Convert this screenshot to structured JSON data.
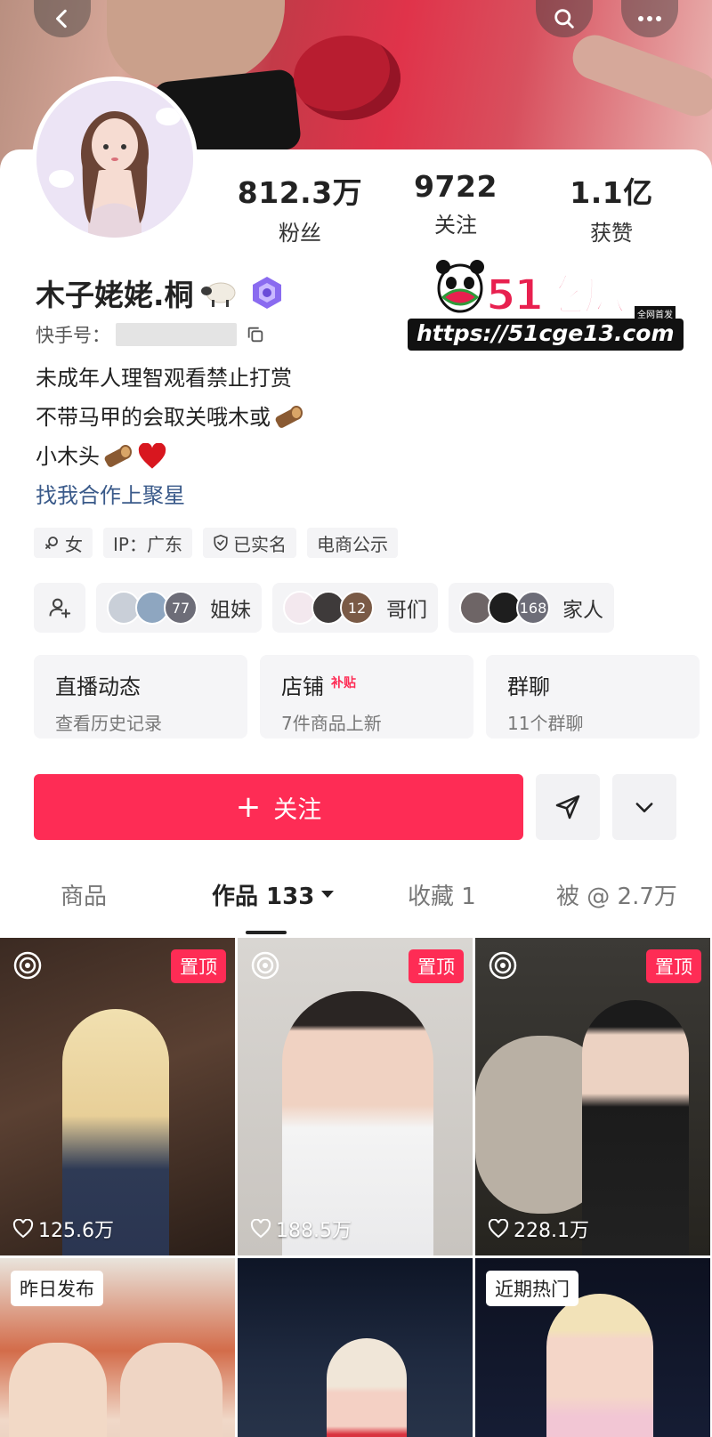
{
  "profile": {
    "stats": [
      {
        "value": "812.3万",
        "label": "粉丝"
      },
      {
        "value": "9722",
        "label": "关注"
      },
      {
        "value": "1.1亿",
        "label": "获赞"
      }
    ],
    "name": "木子姥姥.桐",
    "id_label": "快手号：",
    "bio": [
      "未成年人理智观看禁止打赏",
      "不带马甲的会取关哦木或",
      "小木头"
    ],
    "link": "找我合作上聚星",
    "tags": [
      "女",
      "IP：广东",
      "已实名",
      "电商公示"
    ]
  },
  "groups": [
    {
      "count": "77",
      "label": "姐妹"
    },
    {
      "count": "12",
      "label": "哥们"
    },
    {
      "count": "168",
      "label": "家人"
    }
  ],
  "quick_cards": [
    {
      "title": "直播动态",
      "badge": "",
      "sub": "查看历史记录"
    },
    {
      "title": "店铺",
      "badge": "补贴",
      "sub": "7件商品上新"
    },
    {
      "title": "群聊",
      "badge": "",
      "sub": "11个群聊"
    }
  ],
  "actions": {
    "follow_label": "关注"
  },
  "tabs": [
    {
      "label": "商品"
    },
    {
      "label": "作品 133"
    },
    {
      "label": "收藏 1"
    },
    {
      "label": "被 @ 2.7万"
    }
  ],
  "posts": [
    {
      "pin": "置顶",
      "likes": "125.6万"
    },
    {
      "pin": "置顶",
      "likes": "188.5万"
    },
    {
      "pin": "置顶",
      "likes": "228.1万"
    }
  ],
  "posts_row2": [
    {
      "label": "昨日发布"
    },
    {
      "label": ""
    },
    {
      "label": "近期热门"
    }
  ],
  "watermark": {
    "brand": "51吃瓜",
    "sub": "全网首发",
    "url": "https://51cge13.com"
  },
  "colors": {
    "accent": "#fe2c55",
    "link": "#3a5a8a"
  }
}
